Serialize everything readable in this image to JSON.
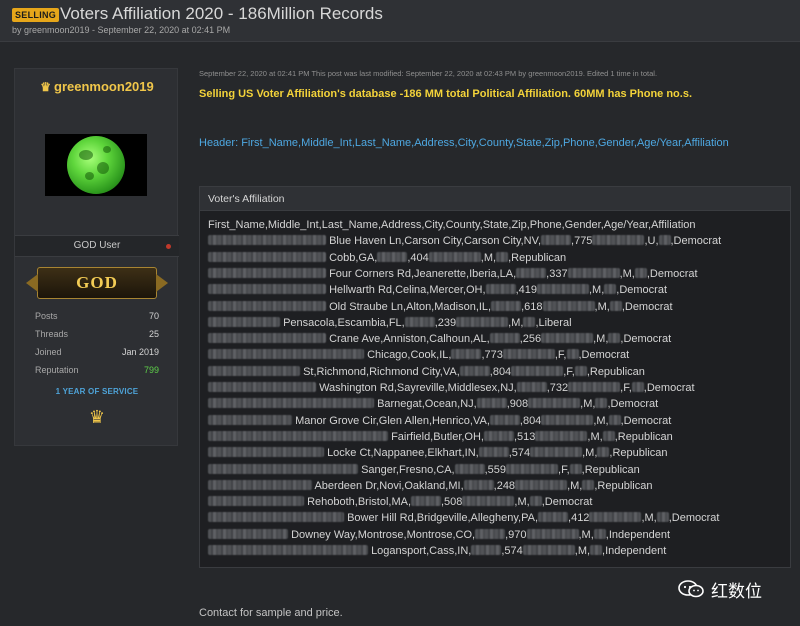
{
  "thread": {
    "badge": "SELLING",
    "title": "Voters Affiliation 2020 - 186Million Records",
    "meta": "by greenmoon2019 - September 22, 2020 at 02:41 PM"
  },
  "user": {
    "name": "greenmoon2019",
    "rank": "GOD User",
    "badge": "GOD",
    "stats": [
      {
        "label": "Posts",
        "value": "70"
      },
      {
        "label": "Threads",
        "value": "25"
      },
      {
        "label": "Joined",
        "value": "Jan 2019"
      },
      {
        "label": "Reputation",
        "value": "799"
      }
    ],
    "service": "1 YEAR OF SERVICE",
    "colors": {
      "name": "#f0c64a",
      "reputation": "#5ed04a",
      "service": "#4ea3d8"
    }
  },
  "post": {
    "meta": "September 22, 2020 at 02:41 PM   This post was last modified: September 22, 2020 at 02:43 PM by greenmoon2019. Edited 1 time in total.",
    "headline": "Selling US Voter Affiliation's database -186 MM total Political Affiliation. 60MM has Phone no.s.",
    "header_line": "Header: First_Name,Middle_Int,Last_Name,Address,City,County,State,Zip,Phone,Gender,Age/Year,Affiliation",
    "quote_title": "Voter's Affiliation",
    "quote_header": "First_Name,Middle_Int,Last_Name,Address,City,County,State,Zip,Phone,Gender,Age/Year,Affiliation",
    "records": [
      {
        "p1": "Blue Haven Ln,Carson City,Carson City,NV,",
        "p2": ",775",
        "p3": ",U,",
        "p4": ",Democrat"
      },
      {
        "p1": "Cobb,GA,",
        "p2": ",404",
        "p3": ",M,",
        "p4": ",Republican"
      },
      {
        "p1": "Four Corners Rd,Jeanerette,Iberia,LA,",
        "p2": ",337",
        "p3": ",M,",
        "p4": ",Democrat"
      },
      {
        "p1": "Hellwarth Rd,Celina,Mercer,OH,",
        "p2": ",419",
        "p3": ",M,",
        "p4": ",Democrat"
      },
      {
        "p1": "Old Straube Ln,Alton,Madison,IL,",
        "p2": ",618",
        "p3": ",M,",
        "p4": ",Democrat"
      },
      {
        "p1": "Pensacola,Escambia,FL,",
        "p2": ",239",
        "p3": ",M,",
        "p4": ",Liberal"
      },
      {
        "p1": "Crane Ave,Anniston,Calhoun,AL,",
        "p2": ",256",
        "p3": ",M,",
        "p4": ",Democrat"
      },
      {
        "p1": "Chicago,Cook,IL,",
        "p2": ",773",
        "p3": ",F,",
        "p4": ",Democrat"
      },
      {
        "p1": "St,Richmond,Richmond City,VA,",
        "p2": ",804",
        "p3": ",F,",
        "p4": ",Republican"
      },
      {
        "p1": "Washington Rd,Sayreville,Middlesex,NJ,",
        "p2": ",732",
        "p3": ",F,",
        "p4": ",Democrat"
      },
      {
        "p1": "Barnegat,Ocean,NJ,",
        "p2": ",908",
        "p3": ",M,",
        "p4": ",Democrat"
      },
      {
        "p1": "Manor Grove Cir,Glen Allen,Henrico,VA,",
        "p2": ",804",
        "p3": ",M,",
        "p4": ",Democrat"
      },
      {
        "p1": "Fairfield,Butler,OH,",
        "p2": ",513",
        "p3": ",M,",
        "p4": ",Republican"
      },
      {
        "p1": "Locke Ct,Nappanee,Elkhart,IN,",
        "p2": ",574",
        "p3": ",M,",
        "p4": ",Republican"
      },
      {
        "p1": "Sanger,Fresno,CA,",
        "p2": ",559",
        "p3": ",F,",
        "p4": ",Republican"
      },
      {
        "p1": "Aberdeen Dr,Novi,Oakland,MI,",
        "p2": ",248",
        "p3": ",M,",
        "p4": ",Republican"
      },
      {
        "p1": "Rehoboth,Bristol,MA,",
        "p2": ",508",
        "p3": ",M,",
        "p4": ",Democrat"
      },
      {
        "p1": "Bower Hill Rd,Bridgeville,Allegheny,PA,",
        "p2": ",412",
        "p3": ",M,",
        "p4": ",Democrat"
      },
      {
        "p1": "Downey Way,Montrose,Montrose,CO,",
        "p2": ",970",
        "p3": ",M,",
        "p4": ",Independent"
      },
      {
        "p1": "Logansport,Cass,IN,",
        "p2": ",574",
        "p3": ",M,",
        "p4": ",Independent"
      }
    ],
    "contact": "Contact for sample and price."
  },
  "watermark": {
    "text": "红数位",
    "icon": "wechat-icon"
  },
  "colors": {
    "headline": "#f3d33a",
    "header_line": "#4ea8e2",
    "badge": "#e6a61a",
    "background": "#26282b"
  }
}
